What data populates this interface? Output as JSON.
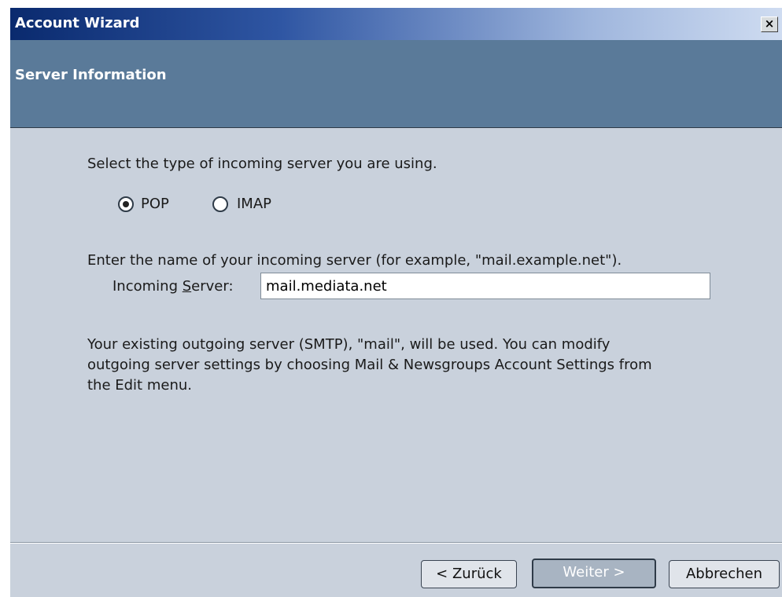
{
  "window": {
    "title": "Account Wizard",
    "close_label": "×"
  },
  "header": {
    "title": "Server Information"
  },
  "server_type": {
    "prompt": "Select the type of incoming server you are using.",
    "options": [
      {
        "label": "POP",
        "selected": true
      },
      {
        "label": "IMAP",
        "selected": false
      }
    ]
  },
  "incoming": {
    "prompt": "Enter the name of your incoming server (for example, \"mail.example.net\").",
    "label_pre": "Incoming ",
    "label_accel": "S",
    "label_post": "erver:",
    "value": "mail.mediata.net"
  },
  "outgoing_note": {
    "line1": "Your existing outgoing server (SMTP), \"mail\", will be used. You can modify",
    "line2": "outgoing server settings by choosing Mail & Newsgroups Account Settings from",
    "line3": "the Edit menu."
  },
  "buttons": {
    "back": "< Zurück",
    "next": "Weiter >",
    "cancel": "Abbrechen"
  }
}
